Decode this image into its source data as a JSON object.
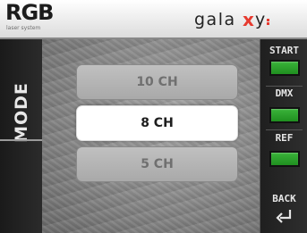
{
  "header": {
    "rgb_logo": "RGB",
    "rgb_sub": "laser system",
    "galaxy_logo": "galaxy"
  },
  "sidebar_left": {
    "title": "MODE"
  },
  "options": [
    {
      "label": "10 CH",
      "selected": false
    },
    {
      "label": "8 CH",
      "selected": true
    },
    {
      "label": "5 CH",
      "selected": false
    }
  ],
  "sidebar_right": {
    "start_label": "START",
    "dmx_label": "DMX",
    "ref_label": "REF",
    "back_label": "BACK",
    "indicator_color": "#2aa52a",
    "back_icon": "return-arrow-icon"
  },
  "colors": {
    "selected_bg": "#ffffff",
    "dim_bg": "#b3b3b3",
    "galaxy_accent": "#e63a2f"
  }
}
